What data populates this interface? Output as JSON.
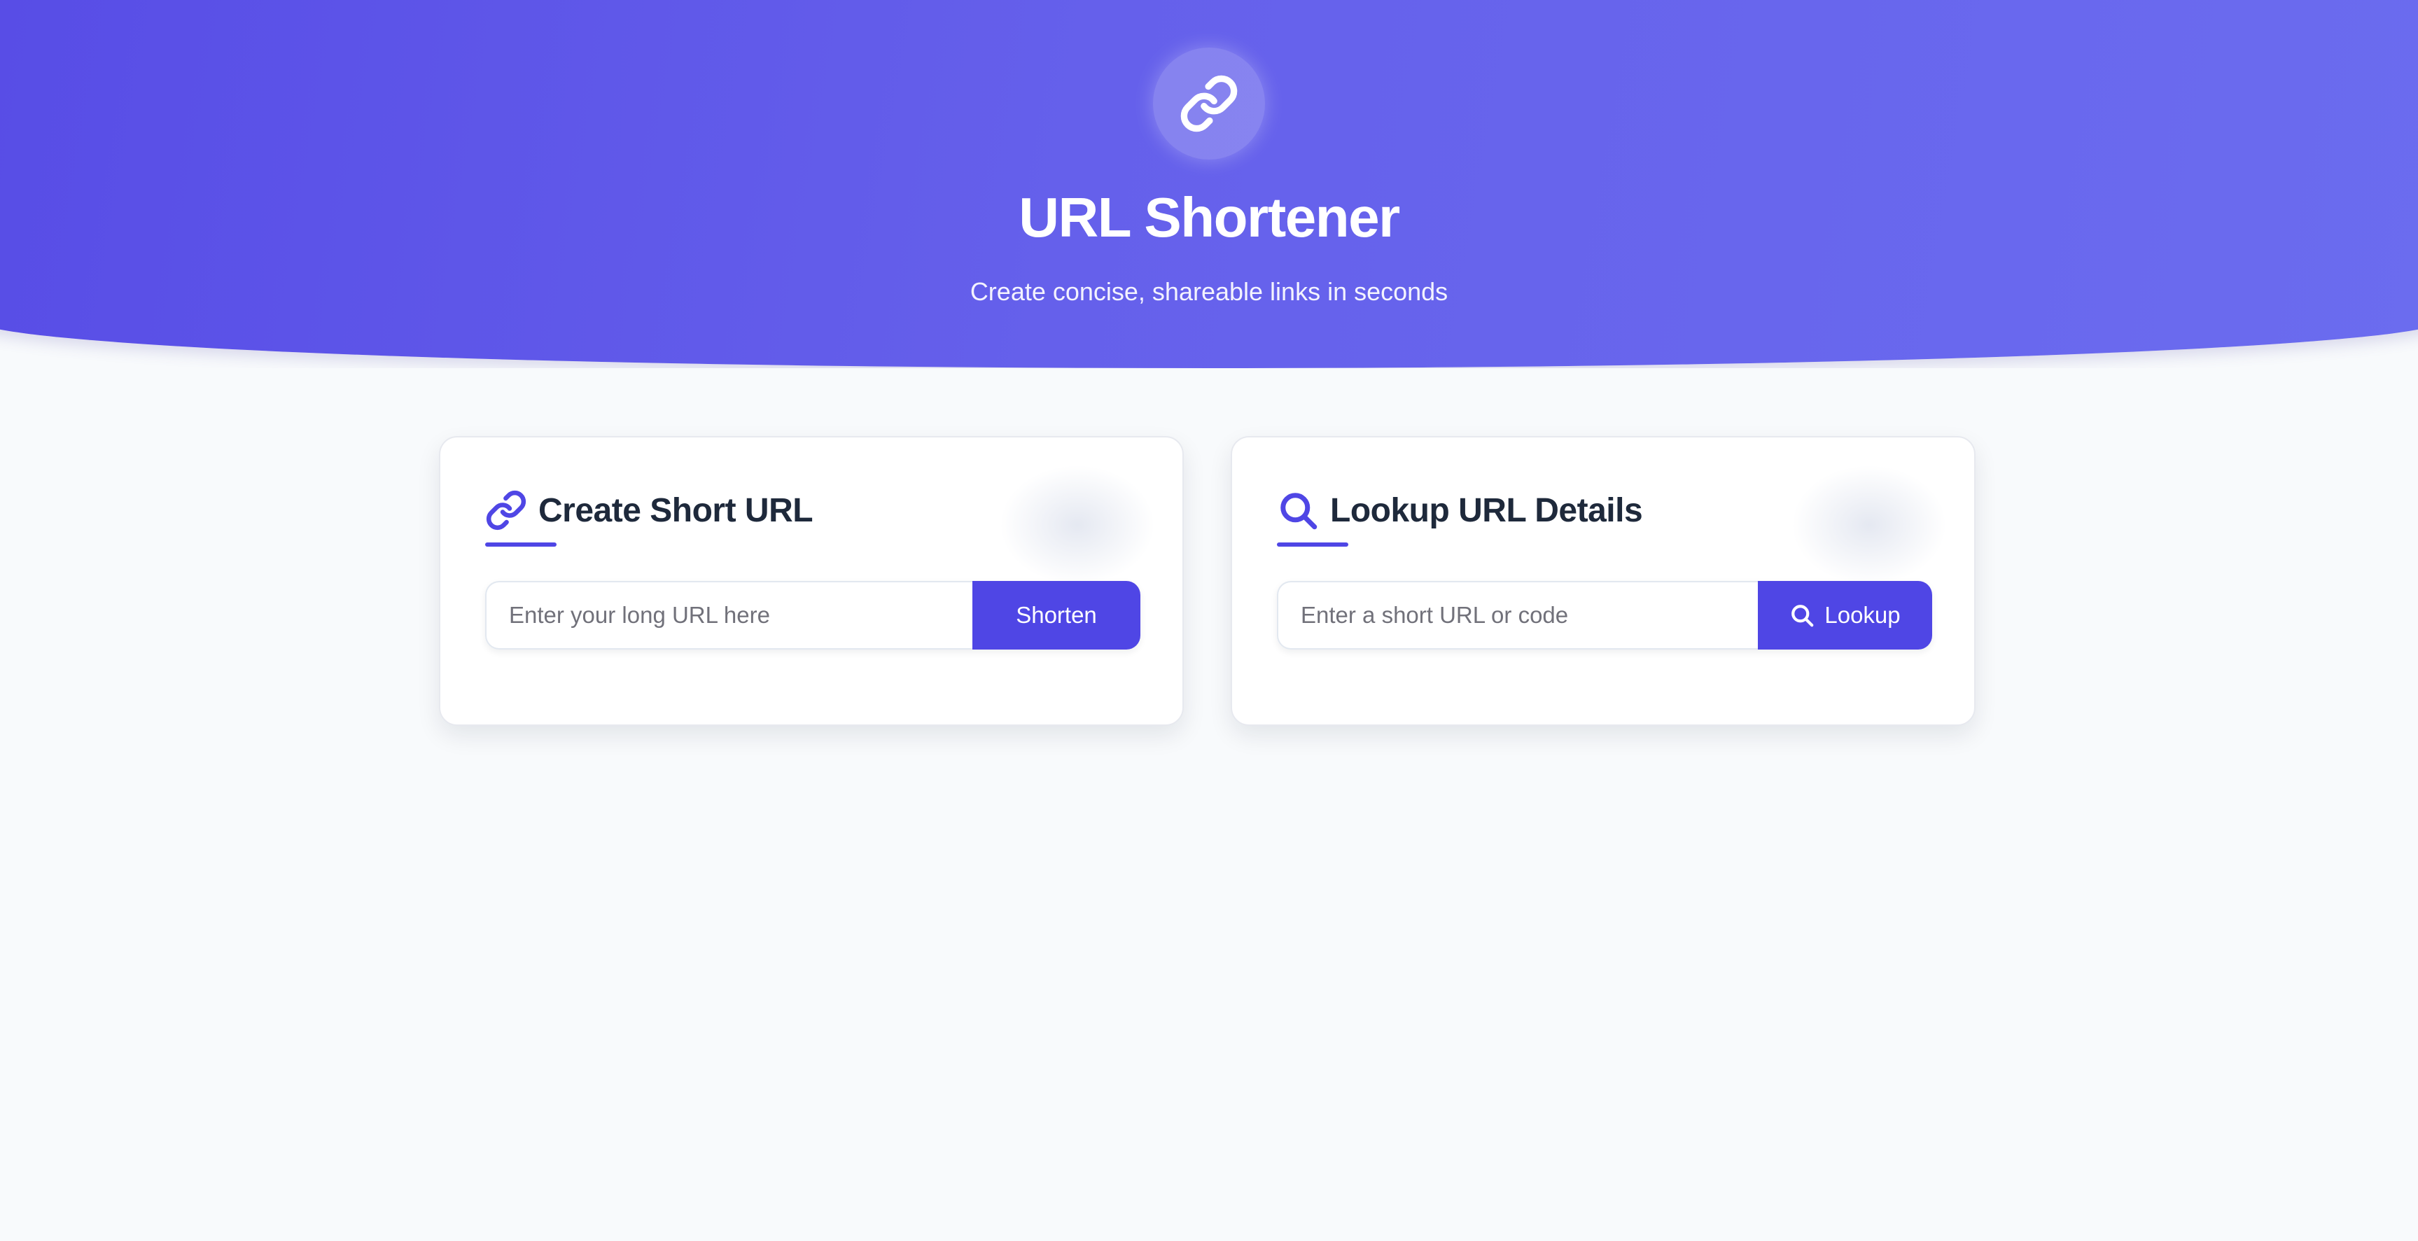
{
  "header": {
    "logo_icon": "link-icon",
    "title": "URL Shortener",
    "subtitle": "Create concise, shareable links in seconds"
  },
  "create_card": {
    "icon": "link-icon",
    "title": "Create Short URL",
    "input": {
      "value": "",
      "placeholder": "Enter your long URL here"
    },
    "button_label": "Shorten"
  },
  "lookup_card": {
    "icon": "search-icon",
    "title": "Lookup URL Details",
    "input": {
      "value": "",
      "placeholder": "Enter a short URL or code"
    },
    "button_icon": "search-icon",
    "button_label": "Lookup"
  },
  "colors": {
    "accent": "#4f46e5",
    "header_gradient_start": "#574ce6",
    "header_gradient_end": "#6b6cef",
    "page_background": "#f8fafc",
    "title_text": "#1e293b"
  }
}
